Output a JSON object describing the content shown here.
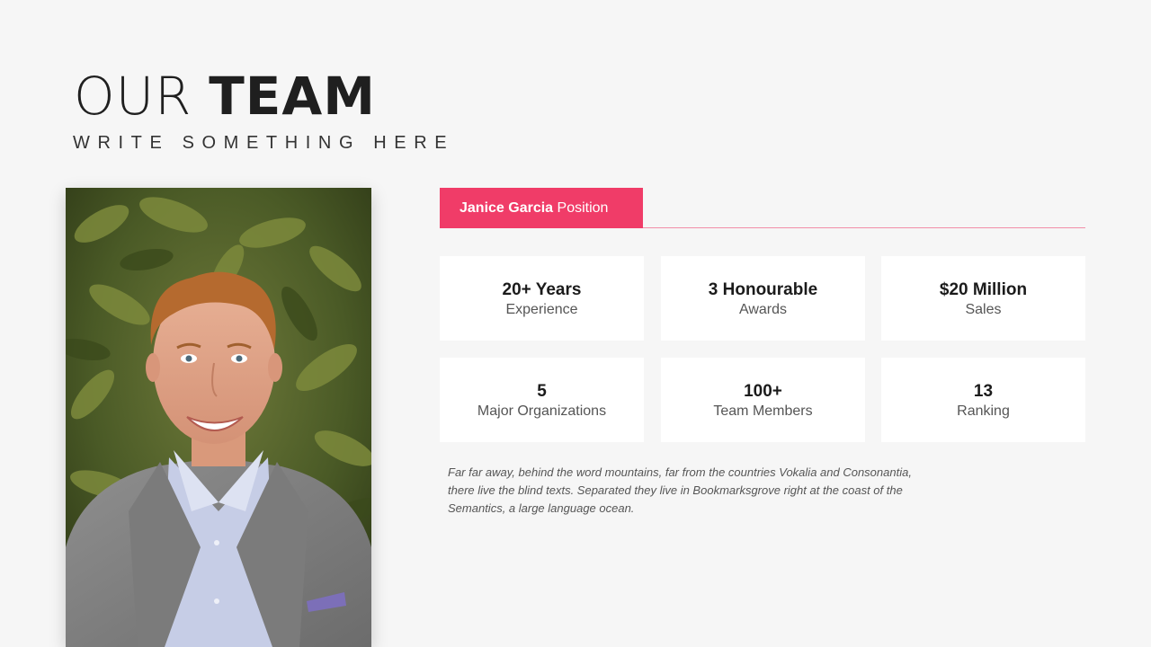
{
  "header": {
    "title_light": "OUR",
    "title_bold": "TEAM",
    "subtitle": "WRITE SOMETHING HERE"
  },
  "member": {
    "name": "Janice Garcia",
    "position": "Position"
  },
  "stats": [
    {
      "value": "20+ Years",
      "label": "Experience"
    },
    {
      "value": "3 Honourable",
      "label": "Awards"
    },
    {
      "value": "$20 Million",
      "label": "Sales"
    },
    {
      "value": "5",
      "label": "Major Organizations"
    },
    {
      "value": "100+",
      "label": "Team Members"
    },
    {
      "value": "13",
      "label": "Ranking"
    }
  ],
  "description": "Far far away, behind the word mountains, far from the countries Vokalia and Consonantia, there live the blind texts. Separated they live in Bookmarksgrove right at the coast of the Semantics, a large language ocean.",
  "colors": {
    "accent": "#f03c68",
    "background": "#f6f6f6",
    "card": "#ffffff"
  }
}
